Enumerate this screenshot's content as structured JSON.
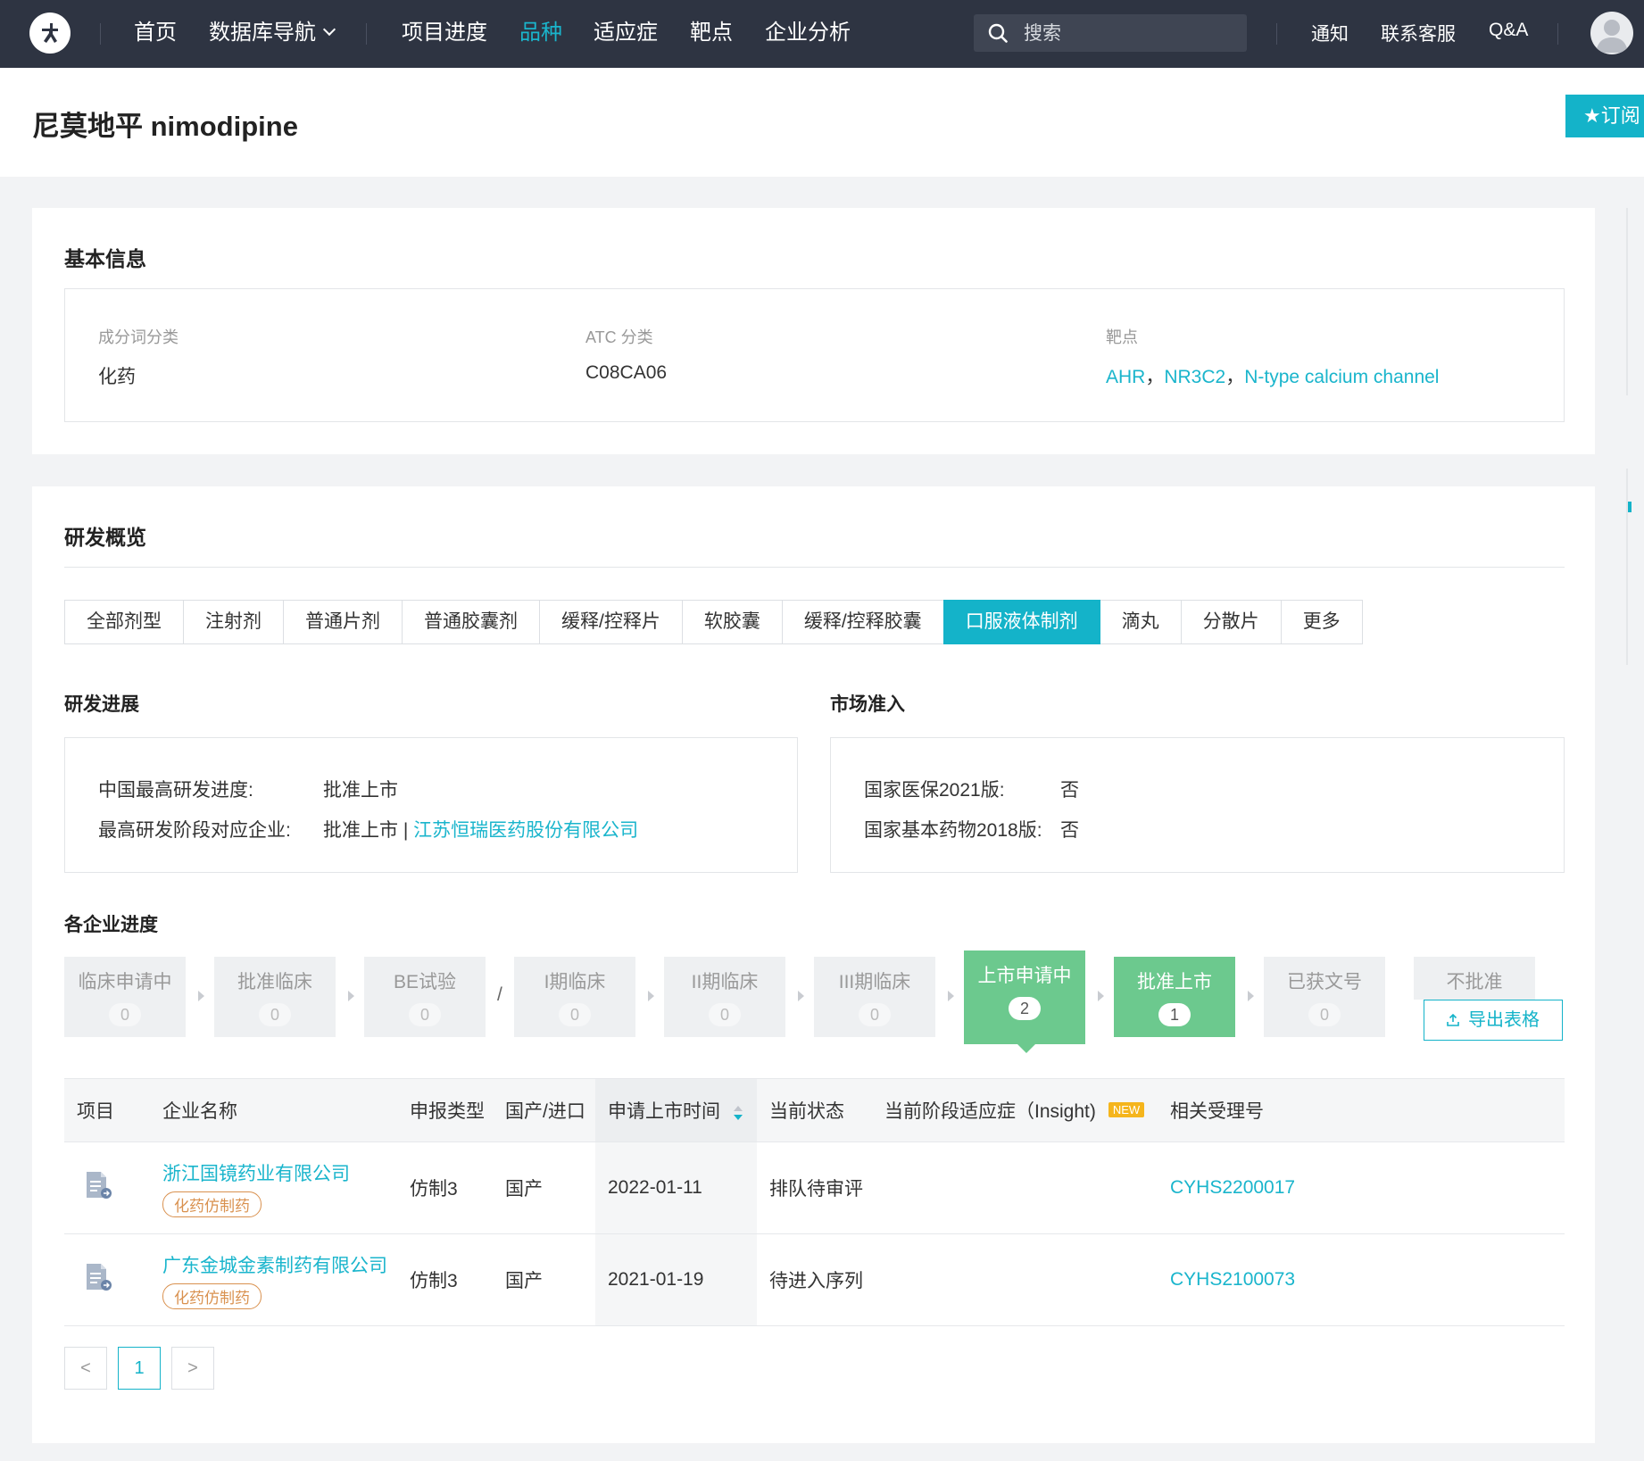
{
  "nav": {
    "home": "首页",
    "db_nav": "数据库导航",
    "project_progress": "项目进度",
    "variety": "品种",
    "indication": "适应症",
    "target": "靶点",
    "company_analysis": "企业分析",
    "search_placeholder": "搜索",
    "notify": "通知",
    "support": "联系客服",
    "qa": "Q&A"
  },
  "page": {
    "title": "尼莫地平 nimodipine",
    "subscribe": "★订阅"
  },
  "basic_info": {
    "title": "基本信息",
    "ingredient_label": "成分词分类",
    "ingredient_value": "化药",
    "atc_label": "ATC 分类",
    "atc_value": "C08CA06",
    "target_label": "靶点",
    "targets": [
      "AHR",
      "NR3C2",
      "N-type calcium channel"
    ],
    "target_sep": "，"
  },
  "overview": {
    "title": "研发概览",
    "tabs": [
      "全部剂型",
      "注射剂",
      "普通片剂",
      "普通胶囊剂",
      "缓释/控释片",
      "软胶囊",
      "缓释/控释胶囊",
      "口服液体制剂",
      "滴丸",
      "分散片",
      "更多"
    ],
    "active_tab": "口服液体制剂",
    "rd_progress": {
      "title": "研发进展",
      "cn_highest_label": "中国最高研发进度:",
      "cn_highest_value": "批准上市",
      "company_label": "最高研发阶段对应企业:",
      "company_stage": "批准上市 | ",
      "company_name": "江苏恒瑞医药股份有限公司"
    },
    "market": {
      "title": "市场准入",
      "insurance_label": "国家医保2021版:",
      "insurance_value": "否",
      "essential_label": "国家基本药物2018版:",
      "essential_value": "否"
    },
    "company_progress": {
      "title": "各企业进度",
      "stages": [
        {
          "name": "临床申请中",
          "count": "0"
        },
        {
          "name": "批准临床",
          "count": "0"
        },
        {
          "name": "BE试验",
          "count": "0"
        },
        {
          "name": "I期临床",
          "count": "0"
        },
        {
          "name": "II期临床",
          "count": "0"
        },
        {
          "name": "III期临床",
          "count": "0"
        },
        {
          "name": "上市申请中",
          "count": "2"
        },
        {
          "name": "批准上市",
          "count": "1"
        },
        {
          "name": "已获文号",
          "count": "0"
        },
        {
          "name": "不批准",
          "count": ""
        }
      ],
      "slash": "/",
      "export": "导出表格"
    },
    "table": {
      "headers": [
        "项目",
        "企业名称",
        "申报类型",
        "国产/进口",
        "申请上市时间",
        "当前状态",
        "当前阶段适应症（Insight)",
        "相关受理号"
      ],
      "new_badge": "NEW",
      "rows": [
        {
          "company": "浙江国镜药业有限公司",
          "tag": "化药仿制药",
          "type": "仿制3",
          "origin": "国产",
          "date": "2022-01-11",
          "status": "排队待审评",
          "indication": "",
          "accept_no": "CYHS2200017"
        },
        {
          "company": "广东金城金素制药有限公司",
          "tag": "化药仿制药",
          "type": "仿制3",
          "origin": "国产",
          "date": "2021-01-19",
          "status": "待进入序列",
          "indication": "",
          "accept_no": "CYHS2100073"
        }
      ]
    },
    "pagination": {
      "prev": "<",
      "current": "1",
      "next": ">"
    }
  }
}
